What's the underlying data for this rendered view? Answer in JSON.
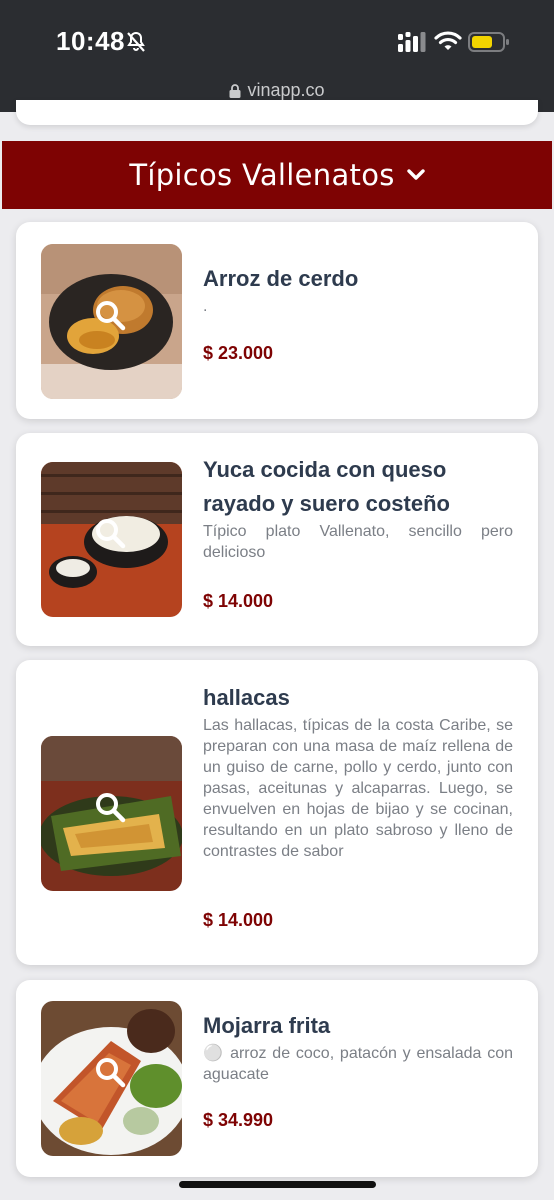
{
  "status_bar": {
    "time": "10:48"
  },
  "browser": {
    "url": "vinapp.co"
  },
  "category": {
    "title": "Típicos Vallenatos"
  },
  "products": [
    {
      "name": "Arroz de cerdo",
      "description": ".",
      "price": "$ 23.000"
    },
    {
      "name": "Yuca cocida con queso rayado y suero costeño",
      "description": "Típico plato Vallenato, sencillo pero delicioso",
      "price": "$ 14.000"
    },
    {
      "name": "hallacas",
      "description": "Las hallacas, típicas de la costa Caribe, se preparan con una masa de maíz rellena de un guiso de carne, pollo y cerdo, junto con pasas, aceitunas y alcaparras. Luego, se envuelven en hojas de bijao y se cocinan, resultando en un plato sabroso y lleno de contrastes de sabor",
      "price": "$ 14.000"
    },
    {
      "name": "Mojarra frita",
      "description": "⚪ arroz de coco, patacón y ensalada con aguacate",
      "price": "$ 34.990"
    }
  ],
  "colors": {
    "accent": "#7e0303",
    "title": "#2e3b4e",
    "description": "#7b7f86"
  }
}
